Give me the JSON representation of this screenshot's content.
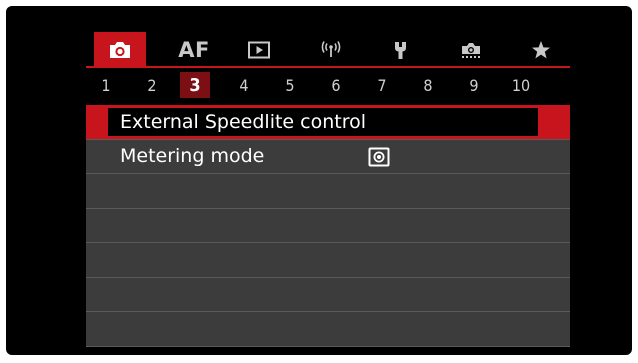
{
  "colors": {
    "accent": "#c8141d",
    "page_active": "#7b0f14",
    "row_bg": "#3c3c3c",
    "screen_bg": "#000000"
  },
  "tabs": [
    {
      "name": "shooting",
      "icon": "camera-icon",
      "active": true
    },
    {
      "name": "af",
      "label": "AF",
      "active": false
    },
    {
      "name": "playback",
      "icon": "playback-icon",
      "active": false
    },
    {
      "name": "wireless",
      "icon": "wireless-icon",
      "active": false
    },
    {
      "name": "setup",
      "icon": "wrench-icon",
      "active": false
    },
    {
      "name": "custom-functions",
      "icon": "custom-function-icon",
      "active": false
    },
    {
      "name": "my-menu",
      "icon": "star-icon",
      "active": false
    }
  ],
  "pages": [
    "1",
    "2",
    "3",
    "4",
    "5",
    "6",
    "7",
    "8",
    "9",
    "10"
  ],
  "active_page": "3",
  "menu": {
    "items": [
      {
        "label": "External Speedlite control",
        "selected": true
      },
      {
        "label": "Metering mode",
        "value_icon": "evaluative-metering-icon",
        "selected": false
      },
      {
        "label": ""
      },
      {
        "label": ""
      },
      {
        "label": ""
      },
      {
        "label": ""
      },
      {
        "label": ""
      }
    ]
  }
}
